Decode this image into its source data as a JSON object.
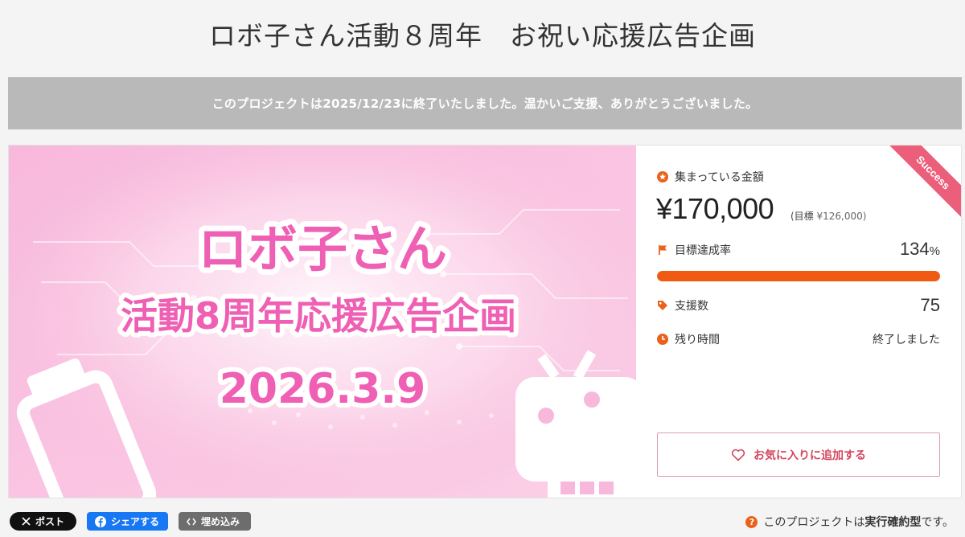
{
  "page": {
    "title": "ロボ子さん活動８周年　お祝い応援広告企画"
  },
  "notice": {
    "text": "このプロジェクトは2025/12/23に終了いたしました。温かいご支援、ありがとうございました。"
  },
  "hero": {
    "line1": "ロボ子さん",
    "line2": "活動8周年応援広告企画",
    "date": "2026.3.9"
  },
  "status": {
    "ribbon": "Success",
    "collected_label": "集まっている金額",
    "amount": "¥170,000",
    "goal_prefix": "(目標",
    "goal_value": "¥126,000)",
    "rate_label": "目標達成率",
    "rate_value": "134",
    "rate_unit": "%",
    "progress_fraction": 1.0,
    "supporters_label": "支援数",
    "supporters_value": "75",
    "remaining_label": "残り時間",
    "remaining_value": "終了しました"
  },
  "favorite_button": {
    "label": "お気に入りに追加する"
  },
  "share": {
    "x_label": "ポスト",
    "fb_label": "シェアする",
    "embed_label": "埋め込み"
  },
  "footer_note": {
    "prefix": "このプロジェクトは",
    "emphasis": "実行確約型",
    "suffix": "です。"
  },
  "colors": {
    "accent": "#f15a13",
    "ribbon": "#ec5f7b",
    "favorite": "#d3475f",
    "hero_text": "#ef5fb4",
    "hero_bg": "#f9c6e2"
  },
  "icons": {
    "collected": "star-coin-icon",
    "rate": "flag-icon",
    "supporters": "tag-icon",
    "remaining": "clock-icon",
    "favorite": "heart-icon"
  }
}
